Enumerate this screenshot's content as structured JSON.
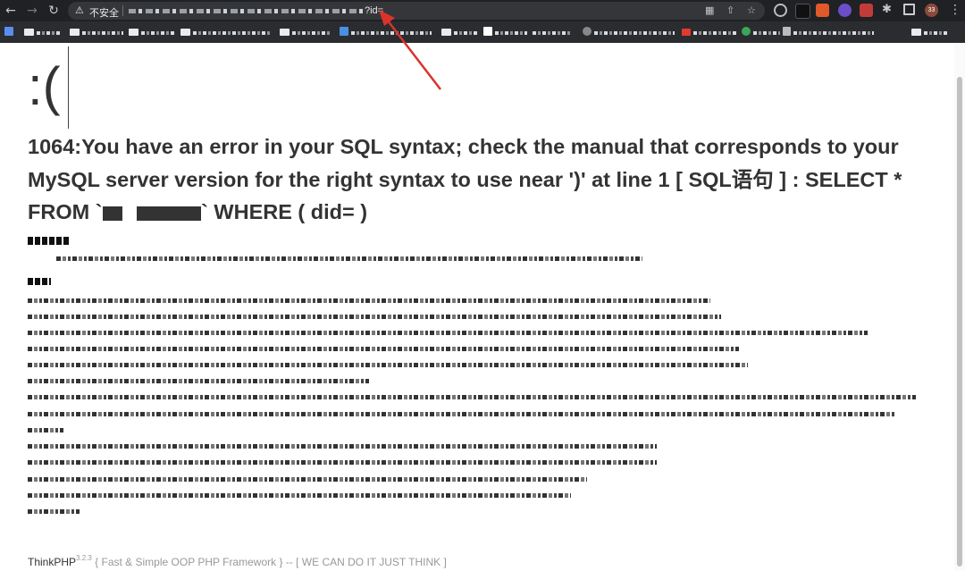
{
  "browser": {
    "security_label": "不安全",
    "url_tail": "?id=",
    "profile_badge": "33",
    "bookmarks": [
      {
        "label": "SQL语句"
      }
    ]
  },
  "page": {
    "face": ":(",
    "error": {
      "prefix": "1064:You have an error in your SQL syntax; check the manual that corresponds to your MySQL server version for the right syntax to use near ')' at line 1 [ SQL语句 ] : SELECT * FROM `",
      "middle": "`",
      "suffix": " WHERE ( did= )"
    },
    "footer": {
      "brand": "ThinkPHP",
      "version": "3.2.3",
      "slogan": " { Fast & Simple OOP PHP Framework } -- [ WE CAN DO IT JUST THINK ]"
    }
  },
  "colors": {
    "arrow": "#d9332b",
    "chrome": "#202124"
  }
}
